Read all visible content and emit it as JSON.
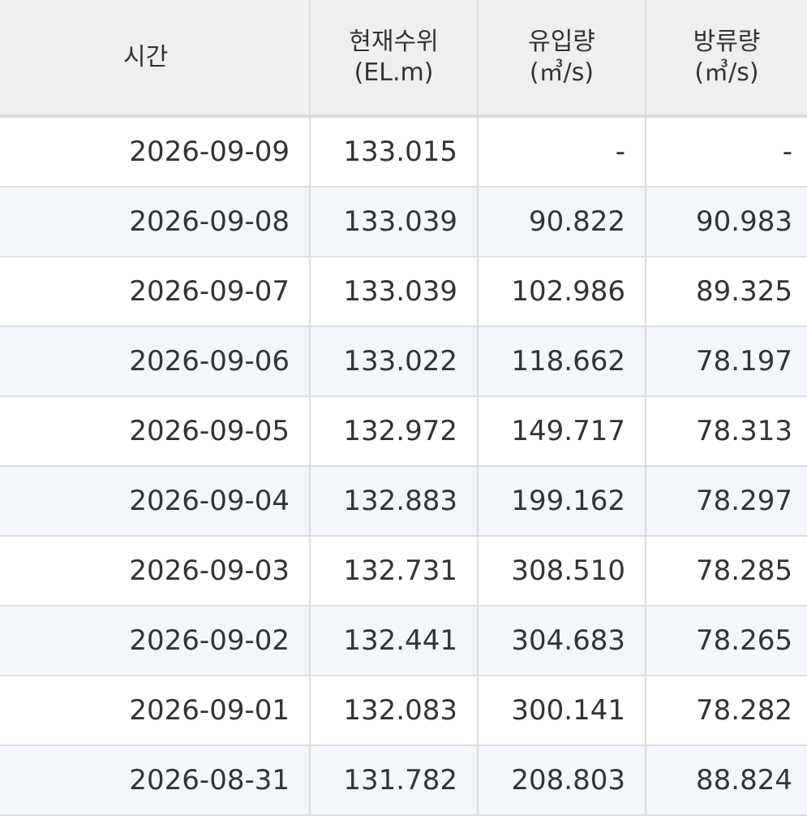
{
  "table": {
    "headers": {
      "time": "시간",
      "level_line1": "현재수위",
      "level_line2": "(EL.m)",
      "inflow_line1": "유입량",
      "inflow_line2": "(㎥/s)",
      "outflow_line1": "방류량",
      "outflow_line2": "(㎥/s)"
    },
    "rows": [
      {
        "time": "2026-09-09",
        "level": "133.015",
        "inflow": "-",
        "outflow": "-"
      },
      {
        "time": "2026-09-08",
        "level": "133.039",
        "inflow": "90.822",
        "outflow": "90.983"
      },
      {
        "time": "2026-09-07",
        "level": "133.039",
        "inflow": "102.986",
        "outflow": "89.325"
      },
      {
        "time": "2026-09-06",
        "level": "133.022",
        "inflow": "118.662",
        "outflow": "78.197"
      },
      {
        "time": "2026-09-05",
        "level": "132.972",
        "inflow": "149.717",
        "outflow": "78.313"
      },
      {
        "time": "2026-09-04",
        "level": "132.883",
        "inflow": "199.162",
        "outflow": "78.297"
      },
      {
        "time": "2026-09-03",
        "level": "132.731",
        "inflow": "308.510",
        "outflow": "78.285"
      },
      {
        "time": "2026-09-02",
        "level": "132.441",
        "inflow": "304.683",
        "outflow": "78.265"
      },
      {
        "time": "2026-09-01",
        "level": "132.083",
        "inflow": "300.141",
        "outflow": "78.282"
      },
      {
        "time": "2026-08-31",
        "level": "131.782",
        "inflow": "208.803",
        "outflow": "88.824"
      }
    ]
  }
}
